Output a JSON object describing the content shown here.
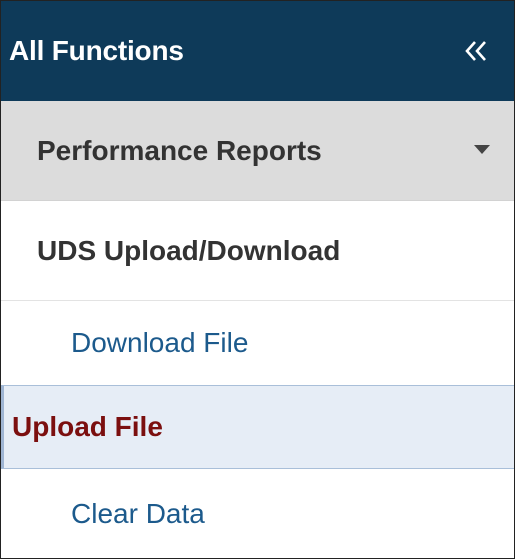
{
  "header": {
    "title": "All Functions",
    "collapse_icon": "double-chevron-left-icon",
    "background": "#0e3a59"
  },
  "menu": {
    "performance_reports": {
      "label": "Performance Reports",
      "expand_icon": "caret-down-icon"
    },
    "uds_upload_download": {
      "label": "UDS Upload/Download",
      "items": [
        {
          "label": "Download File",
          "active": false
        },
        {
          "label": "Upload File",
          "active": true
        },
        {
          "label": "Clear Data",
          "active": false
        }
      ]
    }
  },
  "colors": {
    "link": "#1c5a8c",
    "active_text": "#7b0f0f",
    "active_bg": "#e6edf6"
  }
}
